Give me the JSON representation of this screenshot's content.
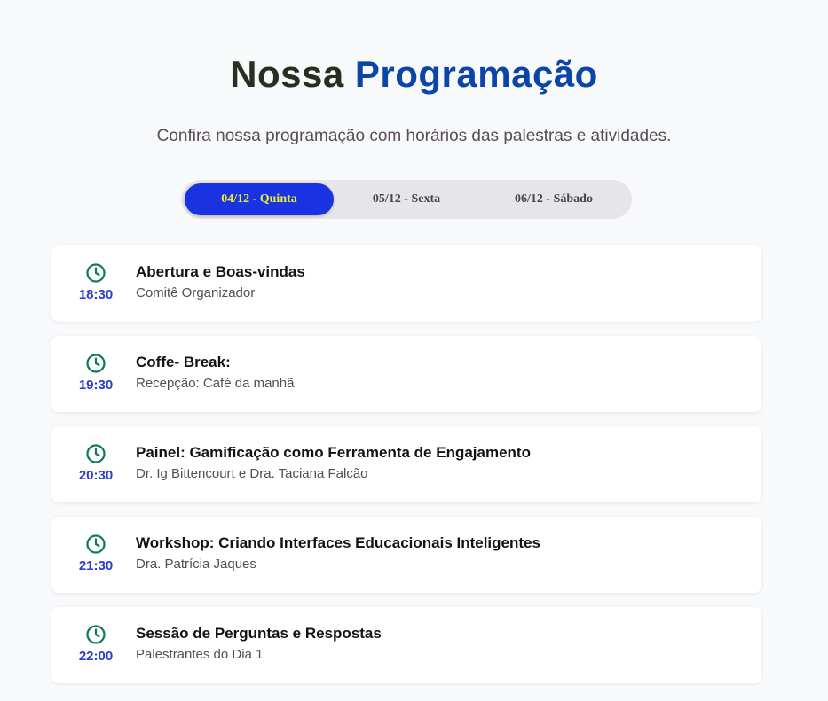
{
  "header": {
    "title_part1": "Nossa",
    "title_part2": "Programação",
    "subtitle": "Confira nossa programação com horários das palestras e atividades."
  },
  "tabs": [
    {
      "label": "04/12 - Quinta",
      "active": true
    },
    {
      "label": "05/12 - Sexta",
      "active": false
    },
    {
      "label": "06/12 - Sábado",
      "active": false
    }
  ],
  "schedule": [
    {
      "time": "18:30",
      "title": "Abertura e Boas-vindas",
      "subtitle": "Comitê Organizador",
      "icon": "clock-icon"
    },
    {
      "time": "19:30",
      "title": "Coffe- Break:",
      "subtitle": "Recepção: Café da manhã",
      "icon": "clock-icon"
    },
    {
      "time": "20:30",
      "title": "Painel: Gamificação como Ferramenta de Engajamento",
      "subtitle": "Dr. Ig Bittencourt e Dra. Taciana Falcão",
      "icon": "clock-icon"
    },
    {
      "time": "21:30",
      "title": "Workshop: Criando Interfaces Educacionais Inteligentes",
      "subtitle": "Dra. Patrícia Jaques",
      "icon": "clock-icon"
    },
    {
      "time": "22:00",
      "title": "Sessão de Perguntas e Respostas",
      "subtitle": "Palestrantes do Dia 1",
      "icon": "clock-icon"
    }
  ],
  "colors": {
    "title_dark": "#253020",
    "title_accent": "#0b45a8",
    "tab_active_bg": "#1a33e0",
    "tab_active_text": "#e9ef37",
    "time_color": "#2b3bd0",
    "clock_color": "#0e7a5a"
  }
}
